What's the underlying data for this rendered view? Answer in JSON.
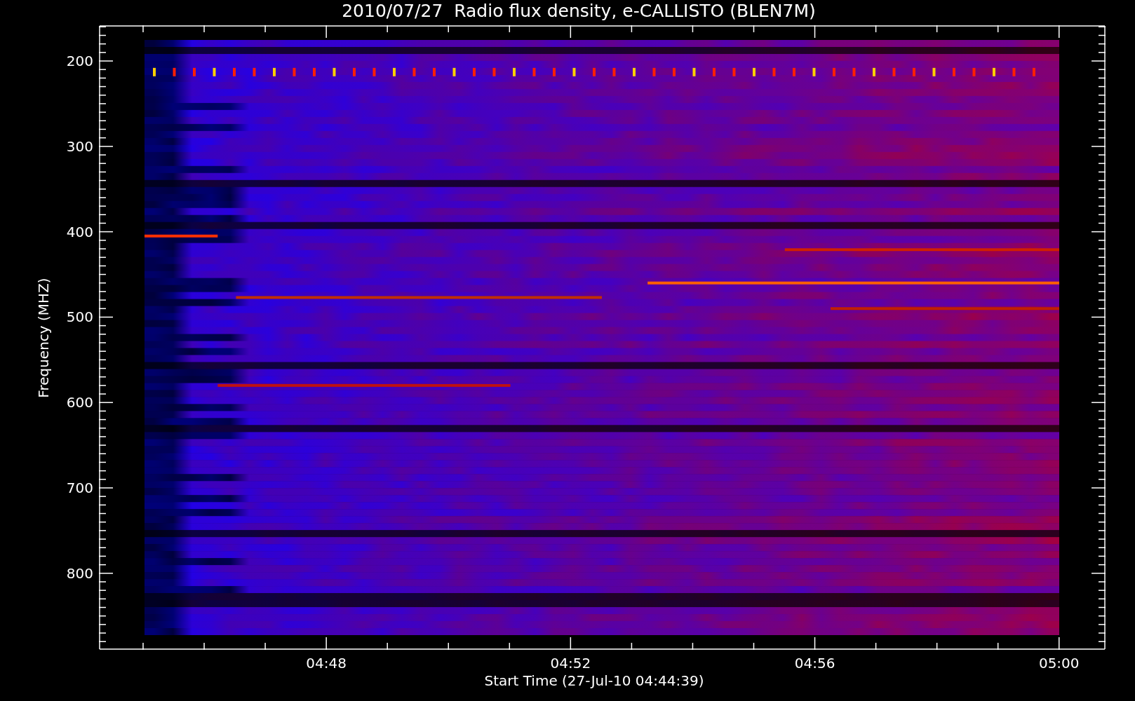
{
  "title": "2010/07/27  Radio flux density, e-CALLISTO (BLEN7M)",
  "y_axis": {
    "label": "Frequency (MHZ)",
    "ticks": [
      "200",
      "300",
      "400",
      "500",
      "600",
      "700",
      "800"
    ]
  },
  "x_axis": {
    "label": "Start Time (27-Jul-10 04:44:39)",
    "ticks": [
      "04:48",
      "04:52",
      "04:56",
      "05:00"
    ]
  }
}
